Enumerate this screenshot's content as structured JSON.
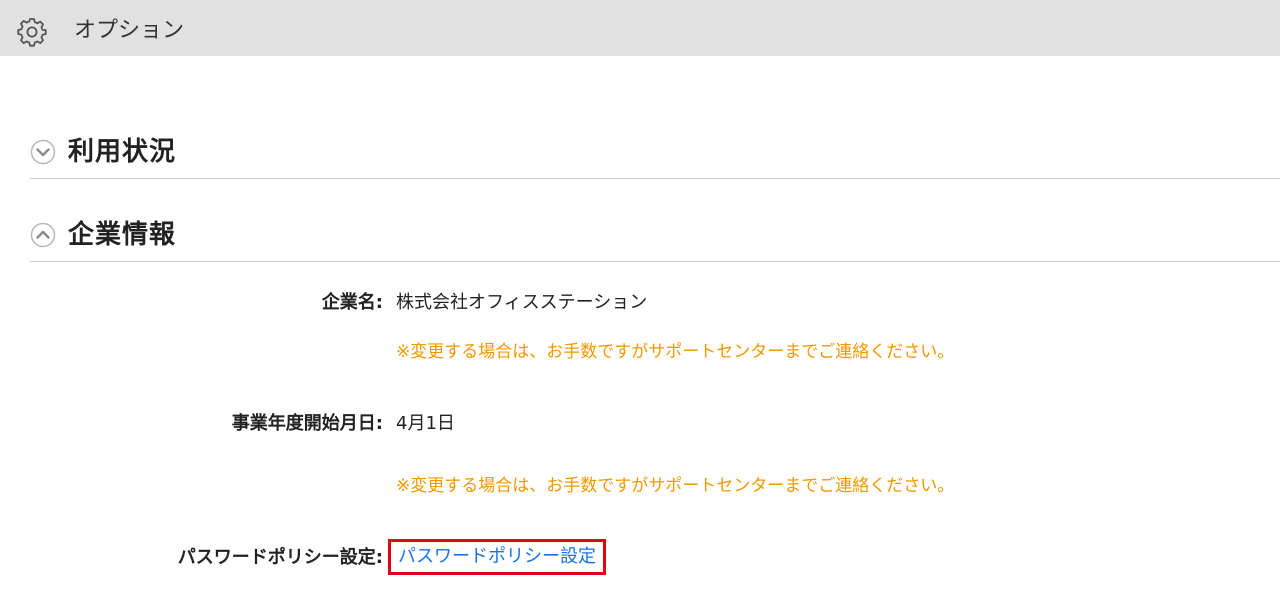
{
  "header": {
    "icon": "gear-icon",
    "title": "オプション"
  },
  "sections": {
    "usage": {
      "icon": "chevron-down-circle-icon",
      "title": "利用状況",
      "expanded": false
    },
    "company": {
      "icon": "chevron-up-circle-icon",
      "title": "企業情報",
      "expanded": true
    }
  },
  "company_info": {
    "company_name_label": "企業名:",
    "company_name_value": "株式会社オフィスステーション",
    "company_name_note": "※変更する場合は、お手数ですがサポートセンターまでご連絡ください。",
    "fiscal_start_label": "事業年度開始月日:",
    "fiscal_start_value": "4月1日",
    "fiscal_start_note": "※変更する場合は、お手数ですがサポートセンターまでご連絡ください。",
    "password_policy_label": "パスワードポリシー設定:",
    "password_policy_link": "パスワードポリシー設定"
  },
  "colors": {
    "note": "#f39800",
    "link": "#1a73e8",
    "highlight": "#e60012",
    "header_bg": "#e1e1e1"
  }
}
